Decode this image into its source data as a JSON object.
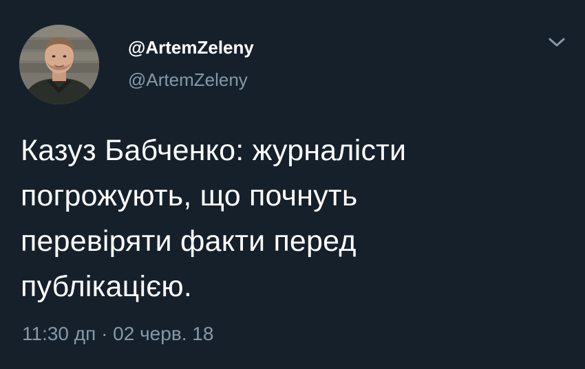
{
  "tweet": {
    "display_name": "@ArtemZeleny",
    "handle": "@ArtemZeleny",
    "text_lines": [
      "Казуз Бабченко: журналісти",
      "погрожують, що почнуть",
      "перевіряти факти перед",
      "публікацією."
    ],
    "time": "11:30 дп",
    "separator": "·",
    "date": "02 черв. 18"
  },
  "icons": {
    "menu": "chevron-down-icon",
    "avatar": "profile-photo"
  },
  "colors": {
    "background": "#15202b",
    "primary_text": "#ffffff",
    "secondary_text": "#8899a6"
  }
}
